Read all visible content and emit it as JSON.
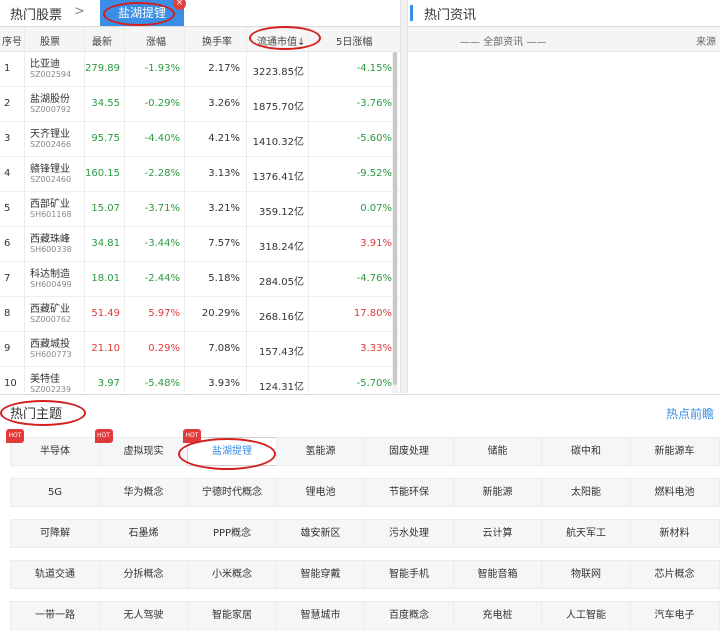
{
  "tabs": {
    "hot_stocks": "热门股票",
    "arrow": ">",
    "active": "盐湖提锂",
    "close": "×"
  },
  "table": {
    "headers": [
      "序号",
      "股票",
      "最新",
      "涨幅",
      "换手率",
      "流通市值",
      "5日涨幅"
    ],
    "sort_arrow": "↓",
    "rows": [
      {
        "idx": "1",
        "name": "比亚迪",
        "code": "SZ002594",
        "price": "279.89",
        "chg": "-1.93%",
        "turn": "2.17%",
        "cap": "3223.85亿",
        "d5": "-4.15%",
        "price_c": "green",
        "chg_c": "green",
        "d5_c": "green"
      },
      {
        "idx": "2",
        "name": "盐湖股份",
        "code": "SZ000792",
        "price": "34.55",
        "chg": "-0.29%",
        "turn": "3.26%",
        "cap": "1875.70亿",
        "d5": "-3.76%",
        "price_c": "green",
        "chg_c": "green",
        "d5_c": "green"
      },
      {
        "idx": "3",
        "name": "天齐锂业",
        "code": "SZ002466",
        "price": "95.75",
        "chg": "-4.40%",
        "turn": "4.21%",
        "cap": "1410.32亿",
        "d5": "-5.60%",
        "price_c": "green",
        "chg_c": "green",
        "d5_c": "green"
      },
      {
        "idx": "4",
        "name": "赣锋锂业",
        "code": "SZ002460",
        "price": "160.15",
        "chg": "-2.28%",
        "turn": "3.13%",
        "cap": "1376.41亿",
        "d5": "-9.52%",
        "price_c": "green",
        "chg_c": "green",
        "d5_c": "green"
      },
      {
        "idx": "5",
        "name": "西部矿业",
        "code": "SH601168",
        "price": "15.07",
        "chg": "-3.71%",
        "turn": "3.21%",
        "cap": "359.12亿",
        "d5": "0.07%",
        "price_c": "green",
        "chg_c": "green",
        "d5_c": "green"
      },
      {
        "idx": "6",
        "name": "西藏珠峰",
        "code": "SH600338",
        "price": "34.81",
        "chg": "-3.44%",
        "turn": "7.57%",
        "cap": "318.24亿",
        "d5": "3.91%",
        "price_c": "green",
        "chg_c": "green",
        "d5_c": "red"
      },
      {
        "idx": "7",
        "name": "科达制造",
        "code": "SH600499",
        "price": "18.01",
        "chg": "-2.44%",
        "turn": "5.18%",
        "cap": "284.05亿",
        "d5": "-4.76%",
        "price_c": "green",
        "chg_c": "green",
        "d5_c": "green"
      },
      {
        "idx": "8",
        "name": "西藏矿业",
        "code": "SZ000762",
        "price": "51.49",
        "chg": "5.97%",
        "turn": "20.29%",
        "cap": "268.16亿",
        "d5": "17.80%",
        "price_c": "red",
        "chg_c": "red",
        "d5_c": "red"
      },
      {
        "idx": "9",
        "name": "西藏城投",
        "code": "SH600773",
        "price": "21.10",
        "chg": "0.29%",
        "turn": "7.08%",
        "cap": "157.43亿",
        "d5": "3.33%",
        "price_c": "red",
        "chg_c": "red",
        "d5_c": "red"
      },
      {
        "idx": "10",
        "name": "美特佳",
        "code": "SZ002239",
        "price": "3.97",
        "chg": "-5.48%",
        "turn": "3.93%",
        "cap": "124.31亿",
        "d5": "-5.70%",
        "price_c": "green",
        "chg_c": "green",
        "d5_c": "green"
      }
    ]
  },
  "news": {
    "title": "热门资讯",
    "filter": "—— 全部资讯 ——",
    "source": "来源"
  },
  "themes": {
    "title": "热门主题",
    "more": "热点前瞻",
    "hot_label": "HOT",
    "chips": [
      "半导体",
      "虚拟现实",
      "盐湖提锂",
      "氢能源",
      "固废处理",
      "储能",
      "碳中和",
      "新能源车",
      "5G",
      "华为概念",
      "宁德时代概念",
      "锂电池",
      "节能环保",
      "新能源",
      "太阳能",
      "燃料电池",
      "可降解",
      "石墨烯",
      "PPP概念",
      "雄安新区",
      "污水处理",
      "云计算",
      "航天军工",
      "新材料",
      "轨道交通",
      "分拆概念",
      "小米概念",
      "智能穿戴",
      "智能手机",
      "智能音箱",
      "物联网",
      "芯片概念",
      "一带一路",
      "无人驾驶",
      "智能家居",
      "智慧城市",
      "百度概念",
      "充电桩",
      "人工智能",
      "汽车电子"
    ],
    "hot_indices": [
      0,
      1,
      2
    ],
    "selected_index": 2
  },
  "colors": {
    "accent": "#3a8ee6",
    "up": "#e03a3a",
    "down": "#2a9a3f",
    "annotation": "#d41f1f"
  }
}
